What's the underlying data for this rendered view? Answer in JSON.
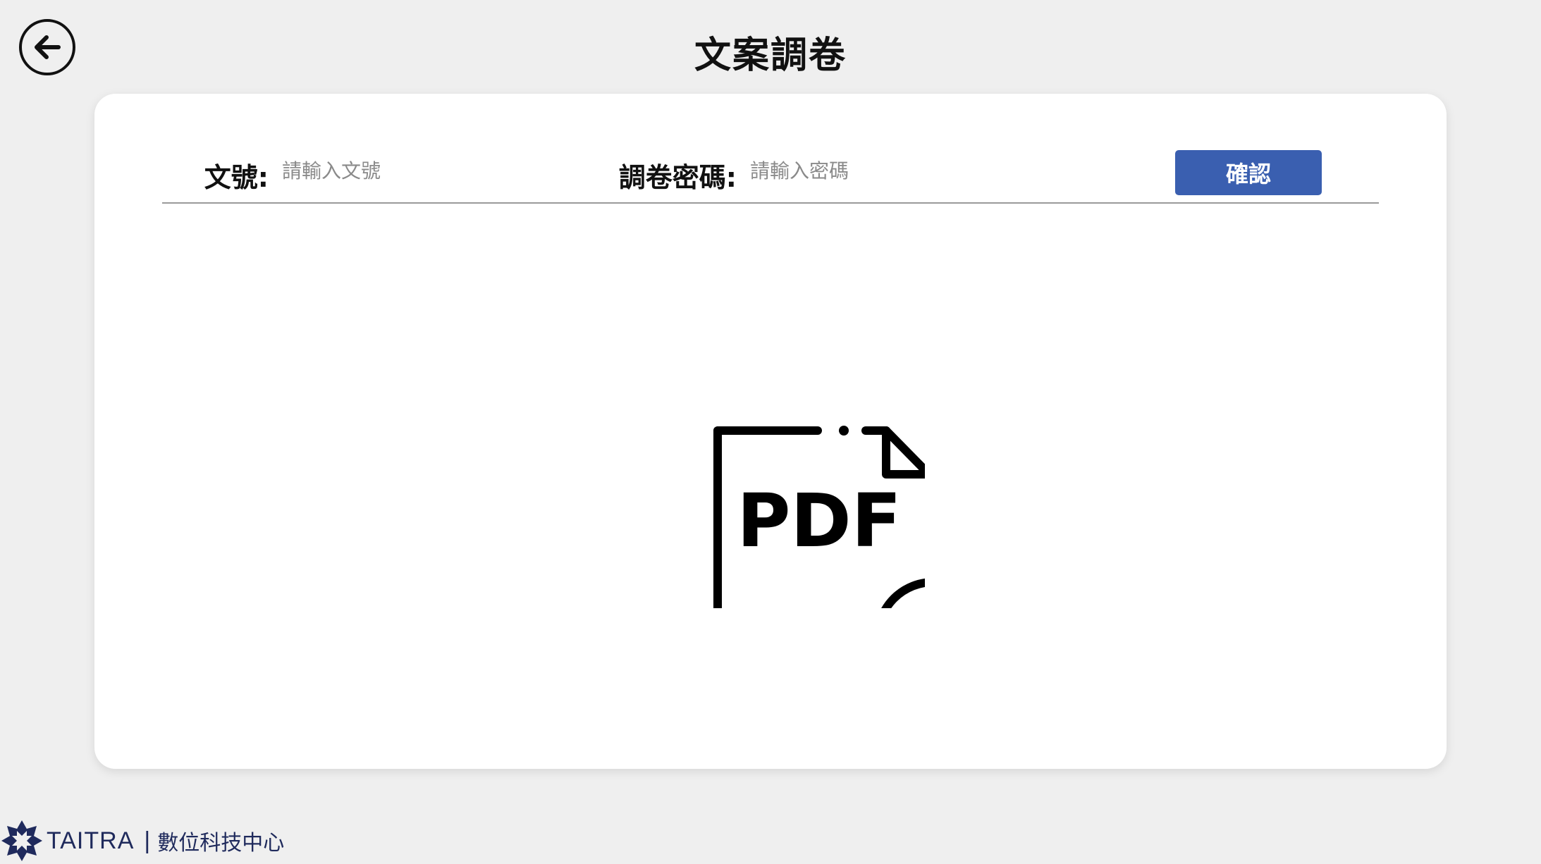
{
  "header": {
    "title": "文案調卷",
    "back_icon": "arrow-left-icon"
  },
  "form": {
    "doc_number_label": "文號:",
    "doc_number_placeholder": "請輸入文號",
    "password_label": "調卷密碼:",
    "password_placeholder": "請輸入密碼",
    "confirm_label": "確認"
  },
  "main": {
    "icon": "pdf-download-icon",
    "icon_text": "PDF"
  },
  "footer": {
    "brand": "TAITRA",
    "divider": "|",
    "department": "數位科技中心"
  },
  "colors": {
    "background": "#efefef",
    "card": "#ffffff",
    "primary_button": "#3a5fb0",
    "brand": "#1f2a5c"
  }
}
